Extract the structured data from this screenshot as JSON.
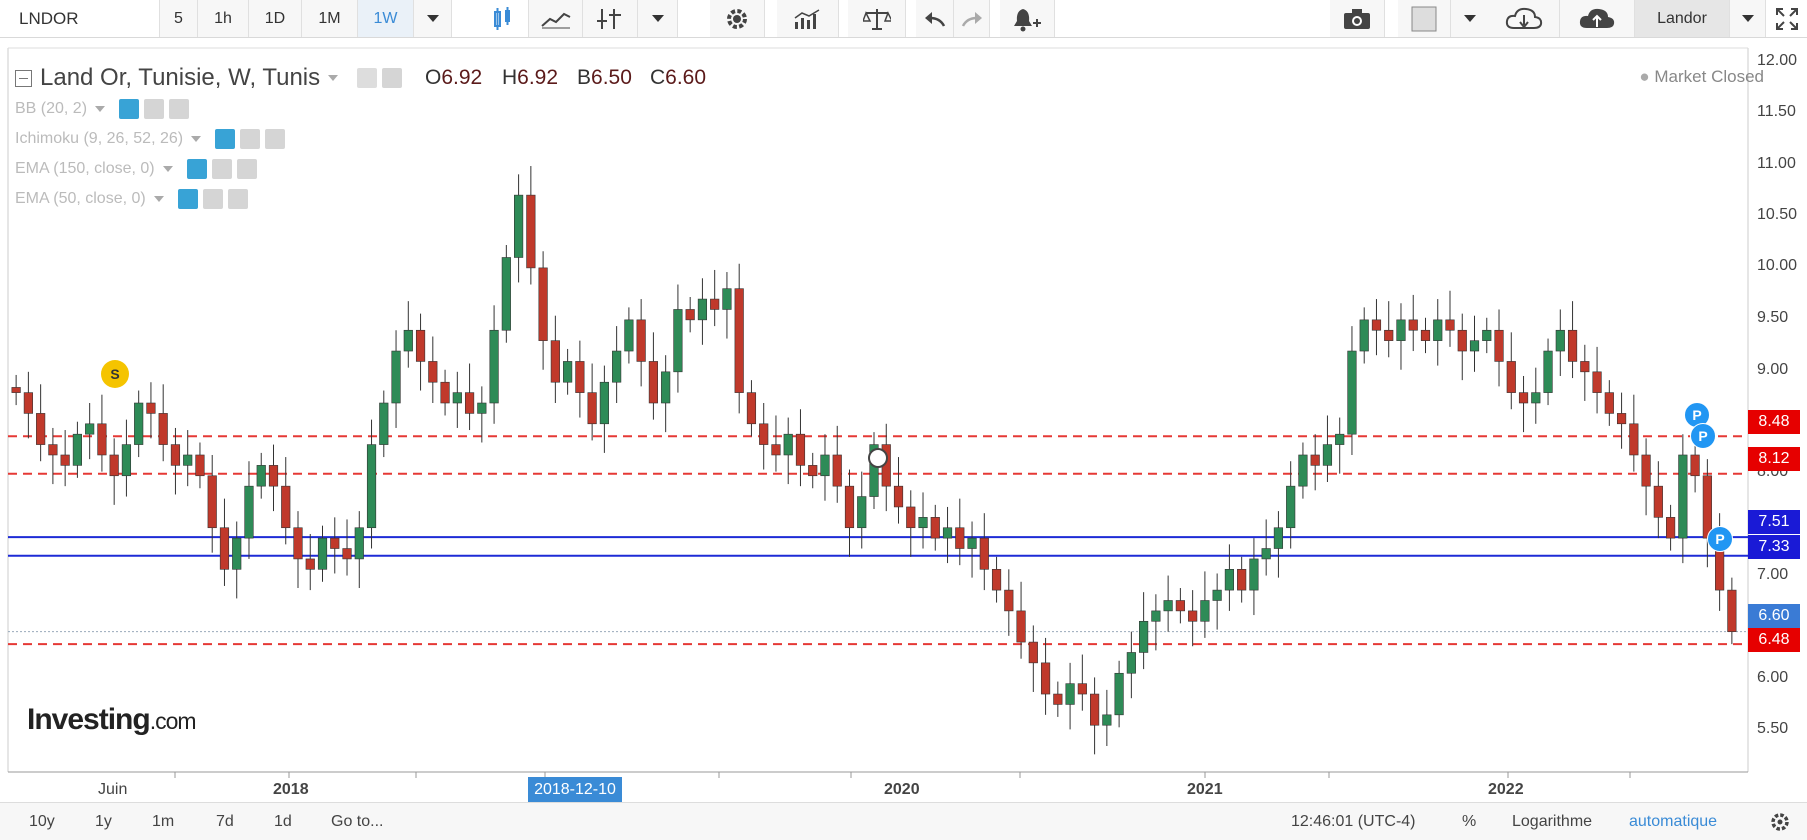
{
  "toolbar": {
    "symbol": "LNDOR",
    "intervals": [
      "5",
      "1h",
      "1D",
      "1M",
      "1W"
    ],
    "active_interval": "1W",
    "account_label": "Landor"
  },
  "legend": {
    "title": "Land Or, Tunisie, W, Tunis",
    "o_label": "O",
    "o_value": "6.92",
    "h_label": "H",
    "h_value": "6.92",
    "b_label": "B",
    "b_value": "6.50",
    "c_label": "C",
    "c_value": "6.60",
    "market_status": "Market Closed",
    "indicators": [
      "BB (20, 2)",
      "Ichimoku (9, 26, 52, 26)",
      "EMA (150, close, 0)",
      "EMA (50, close, 0)"
    ]
  },
  "y_axis": [
    "12.00",
    "11.50",
    "11.00",
    "10.50",
    "10.00",
    "9.50",
    "9.00",
    "8.00",
    "7.00",
    "6.00",
    "5.50"
  ],
  "x_axis": [
    "Juin",
    "2018",
    "2020",
    "2021",
    "2022"
  ],
  "crosshair_date": "2018-12-10",
  "price_tags": {
    "red_high": "8.48",
    "red_mid": "8.12",
    "blue_high": "7.51",
    "blue_low": "7.33",
    "last": "6.60",
    "red_low": "6.48"
  },
  "markers": {
    "signal": "S",
    "position": "P"
  },
  "logo": {
    "main": "Investing",
    "suffix": ".com"
  },
  "bottombar": {
    "ranges": [
      "10y",
      "1y",
      "1m",
      "7d",
      "1d"
    ],
    "goto": "Go to...",
    "time": "12:46:01 (UTC-4)",
    "percent": "%",
    "log": "Logarithme",
    "auto": "automatique"
  },
  "colors": {
    "up": "#2e8b57",
    "down": "#c0392b",
    "hline_red": "#e53935",
    "hline_blue": "#1e2bd6",
    "accent": "#38a3d6"
  },
  "chart_data": {
    "type": "candlestick",
    "title": "Land Or, Tunisie, W, Tunis",
    "y_range": [
      5.25,
      12.1
    ],
    "horizontal_lines": [
      {
        "value": 8.48,
        "style": "dashed",
        "color": "red"
      },
      {
        "value": 8.12,
        "style": "dashed",
        "color": "red"
      },
      {
        "value": 7.51,
        "style": "solid",
        "color": "blue"
      },
      {
        "value": 7.33,
        "style": "solid",
        "color": "blue"
      },
      {
        "value": 6.48,
        "style": "dashed",
        "color": "red"
      }
    ],
    "close_series": [
      8.9,
      8.7,
      8.4,
      8.3,
      8.2,
      8.5,
      8.6,
      8.3,
      8.1,
      8.4,
      8.8,
      8.7,
      8.4,
      8.2,
      8.3,
      8.1,
      7.6,
      7.2,
      7.5,
      8.0,
      8.2,
      8.0,
      7.6,
      7.3,
      7.2,
      7.5,
      7.4,
      7.3,
      7.6,
      8.4,
      8.8,
      9.3,
      9.5,
      9.2,
      9.0,
      8.8,
      8.9,
      8.7,
      8.8,
      9.5,
      10.2,
      10.8,
      10.1,
      9.4,
      9.0,
      9.2,
      8.9,
      8.6,
      9.0,
      9.3,
      9.6,
      9.2,
      8.8,
      9.1,
      9.7,
      9.6,
      9.8,
      9.7,
      9.9,
      8.9,
      8.6,
      8.4,
      8.3,
      8.5,
      8.2,
      8.1,
      8.3,
      8.0,
      7.6,
      7.9,
      8.4,
      8.0,
      7.8,
      7.6,
      7.7,
      7.5,
      7.6,
      7.4,
      7.5,
      7.2,
      7.0,
      6.8,
      6.5,
      6.3,
      6.0,
      5.9,
      6.1,
      6.0,
      5.7,
      5.8,
      6.2,
      6.4,
      6.7,
      6.8,
      6.9,
      6.8,
      6.7,
      6.9,
      7.0,
      7.2,
      7.0,
      7.3,
      7.4,
      7.6,
      8.0,
      8.3,
      8.2,
      8.4,
      8.5,
      9.3,
      9.6,
      9.5,
      9.4,
      9.6,
      9.5,
      9.4,
      9.6,
      9.5,
      9.3,
      9.4,
      9.5,
      9.2,
      8.9,
      8.8,
      8.9,
      9.3,
      9.5,
      9.2,
      9.1,
      8.9,
      8.7,
      8.6,
      8.3,
      8.0,
      7.7,
      7.5,
      8.3,
      8.1,
      7.5,
      7.0,
      6.6
    ]
  }
}
